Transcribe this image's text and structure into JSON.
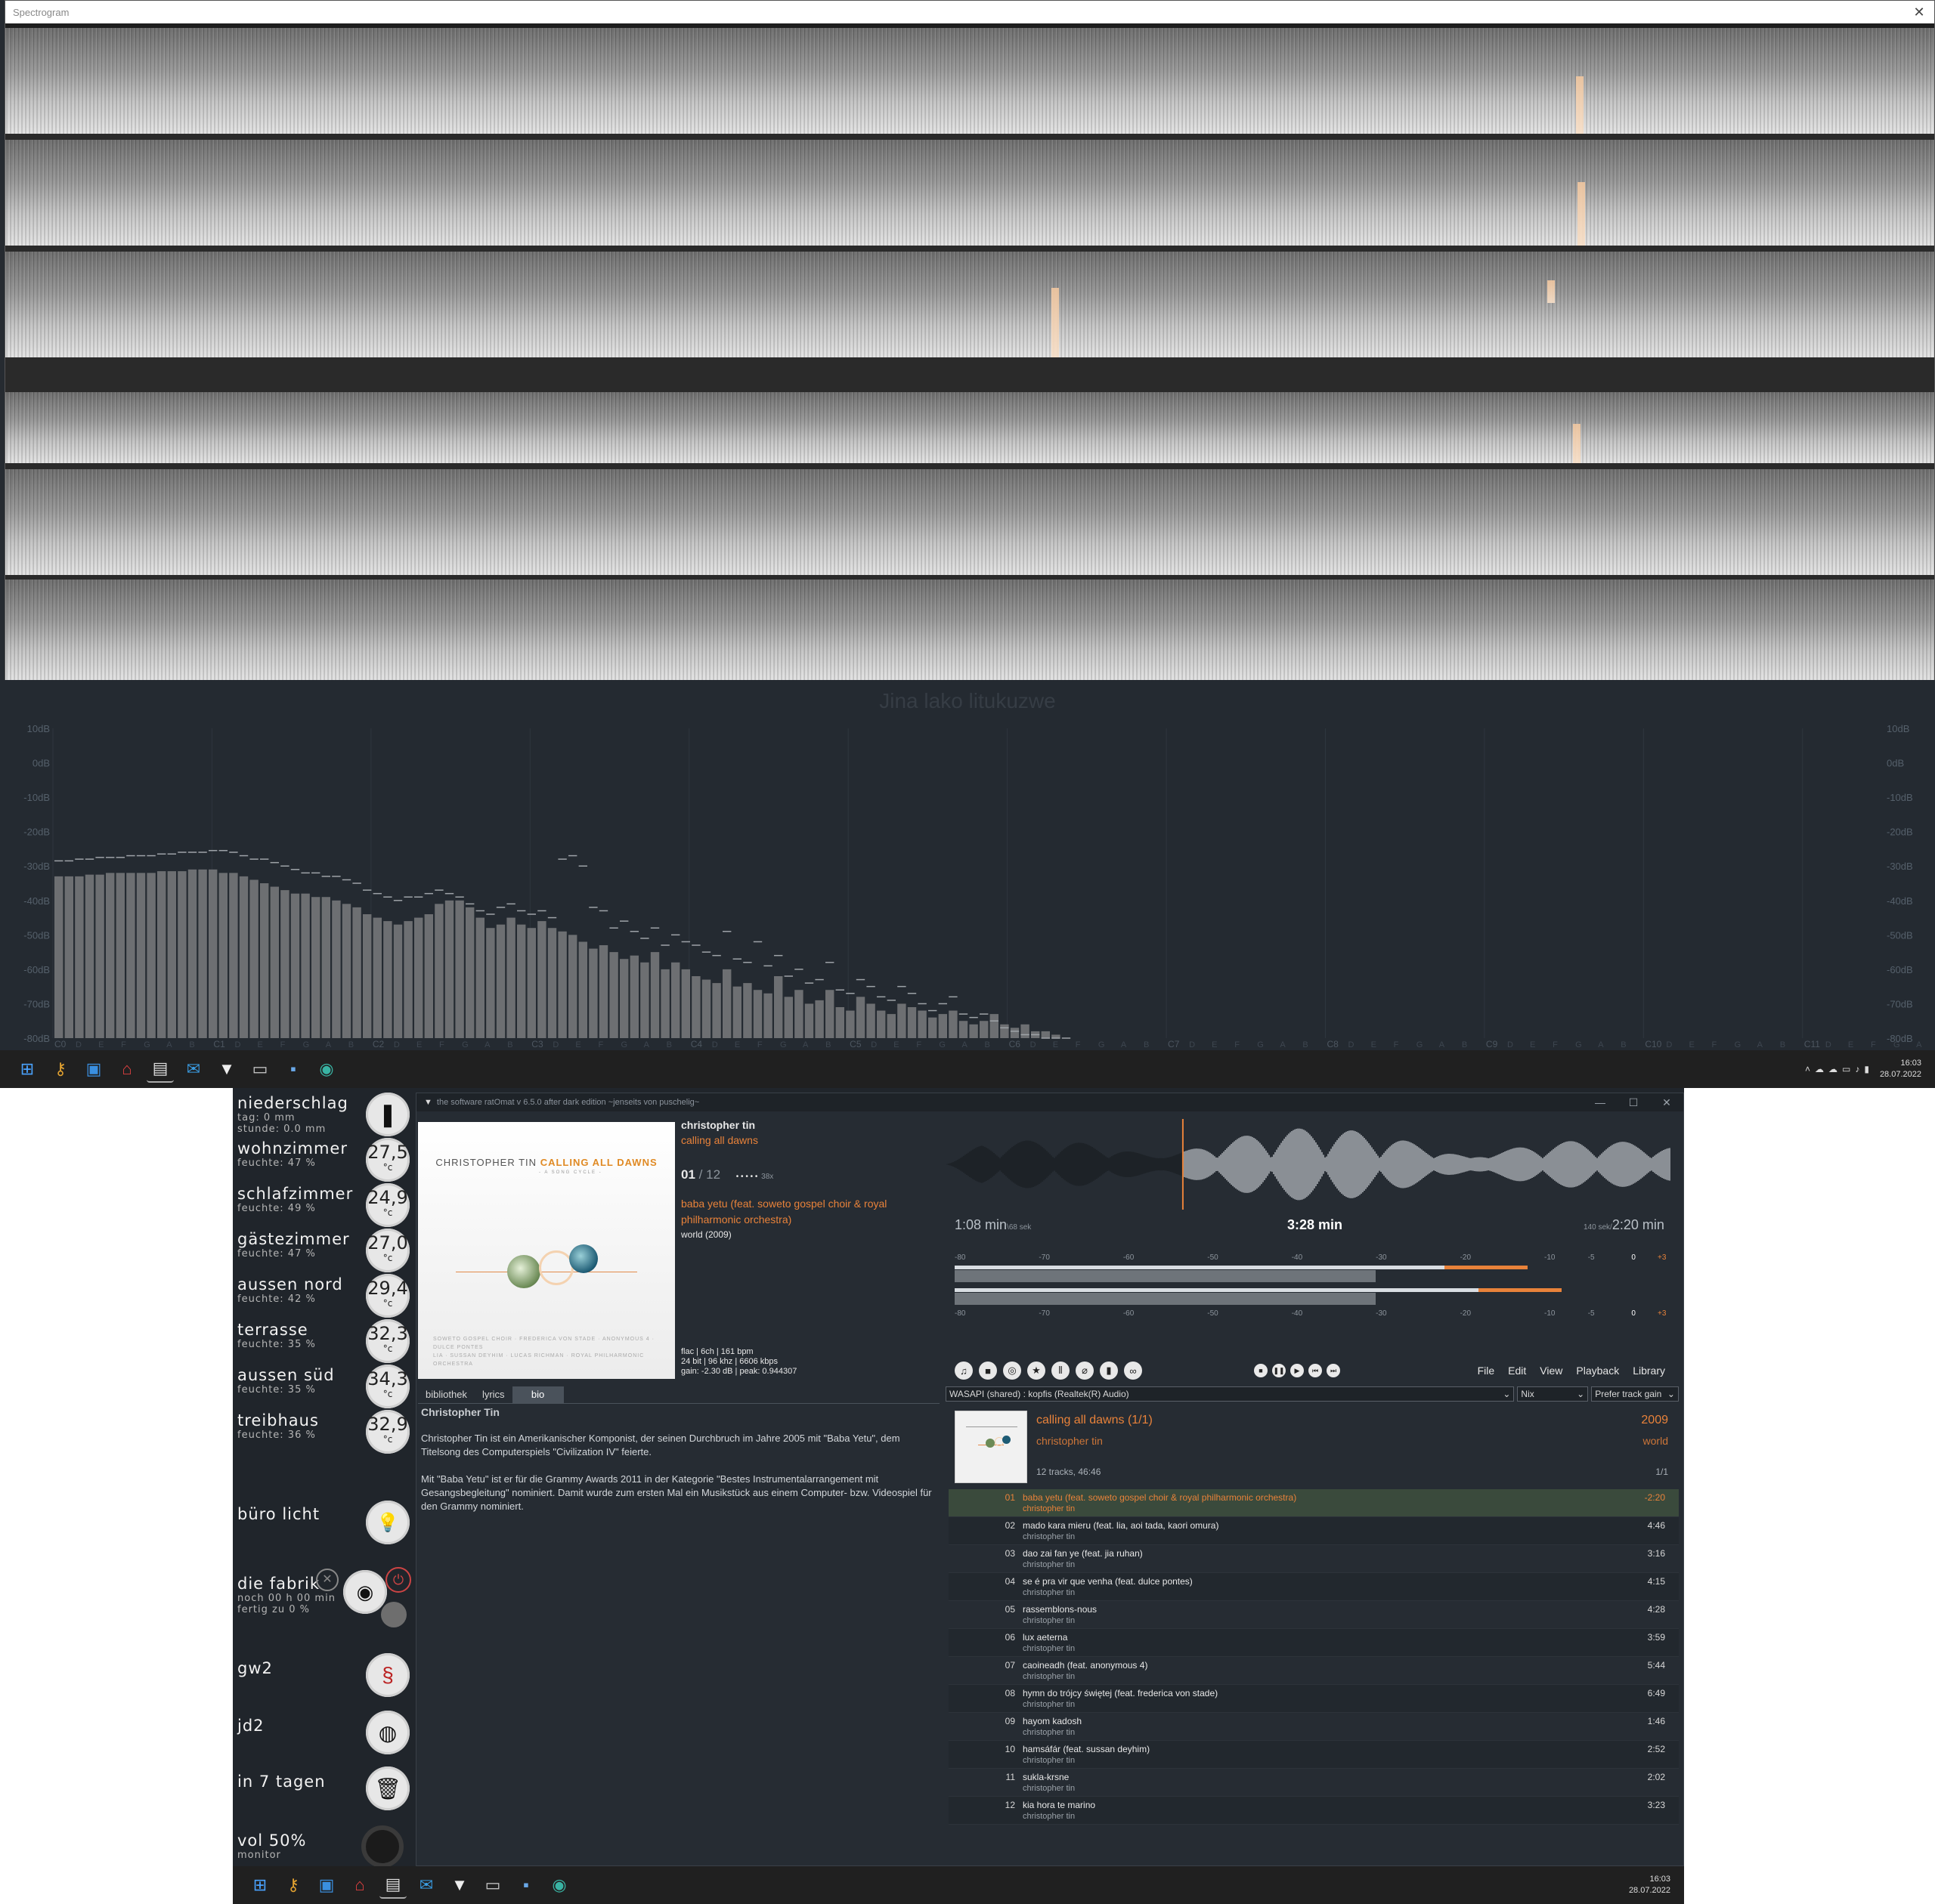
{
  "spectrogram": {
    "title": "Spectrogram",
    "close_glyph": "✕"
  },
  "spectrum": {
    "title": "Jina lako litukuzwe",
    "db_labels": [
      "10dB",
      "0dB",
      "-10dB",
      "-20dB",
      "-30dB",
      "-40dB",
      "-50dB",
      "-60dB",
      "-70dB",
      "-80dB"
    ],
    "octave_labels": [
      "C0",
      "C1",
      "C2",
      "C3",
      "C4",
      "C5",
      "C6",
      "C7",
      "C8",
      "C9",
      "C10",
      "C11"
    ],
    "bar_levels_db": [
      -33,
      -33,
      -33,
      -32.5,
      -32.5,
      -32,
      -32,
      -32,
      -32,
      -32,
      -31.5,
      -31.5,
      -31.5,
      -31,
      -31,
      -31,
      -32,
      -32,
      -33,
      -34,
      -35,
      -36,
      -37,
      -38,
      -38,
      -39,
      -39,
      -40,
      -41,
      -42,
      -44,
      -45,
      -46,
      -47,
      -46,
      -45,
      -44,
      -41,
      -40,
      -40,
      -42,
      -45,
      -48,
      -47,
      -45,
      -47,
      -48,
      -46,
      -48,
      -49,
      -50,
      -52,
      -54,
      -53,
      -55,
      -57,
      -56,
      -58,
      -55,
      -60,
      -58,
      -60,
      -62,
      -63,
      -64,
      -60,
      -65,
      -64,
      -66,
      -67,
      -62,
      -68,
      -66,
      -70,
      -69,
      -66,
      -71,
      -72,
      -68,
      -70,
      -72,
      -73,
      -70,
      -71,
      -72,
      -74,
      -73,
      -72,
      -75,
      -76,
      -75,
      -73,
      -76,
      -77,
      -76,
      -78,
      -78,
      -79,
      -80
    ],
    "peak_levels_db": [
      -28.5,
      -28.5,
      -28,
      -28,
      -27.5,
      -27.5,
      -27.5,
      -27,
      -27,
      -27,
      -26.5,
      -26.5,
      -26,
      -26,
      -26,
      -25.5,
      -25.5,
      -26,
      -27,
      -28,
      -28,
      -29,
      -30,
      -31,
      -32,
      -32,
      -33,
      -33,
      -34,
      -35,
      -37,
      -38,
      -39,
      -40,
      -39,
      -39,
      -38,
      -37,
      -38,
      -39,
      -41,
      -43,
      -44,
      -42,
      -41,
      -43,
      -44,
      -43,
      -45,
      -28,
      -27,
      -30,
      -42,
      -43,
      -48,
      -46,
      -49,
      -51,
      -48,
      -53,
      -50,
      -52,
      -53,
      -55,
      -56,
      -49,
      -57,
      -58,
      -52,
      -59,
      -56,
      -62,
      -60,
      -64,
      -63,
      -58,
      -66,
      -67,
      -63,
      -65,
      -68,
      -69,
      -65,
      -67,
      -70,
      -72,
      -70,
      -68,
      -73,
      -74,
      -73,
      -75,
      -77,
      -78,
      -79,
      -79,
      -80,
      -80,
      -80
    ],
    "tick_letters": [
      "D",
      "E",
      "F",
      "G",
      "A",
      "B"
    ]
  },
  "taskbar_top": {
    "icons": [
      "windows-start-icon",
      "key-icon",
      "window-icon",
      "home-icon",
      "player-icon",
      "mail-icon",
      "fox-icon",
      "terminal-icon",
      "save-icon",
      "edge-icon"
    ],
    "clock_time": "16:03",
    "clock_date": "28.07.2022"
  },
  "rainmeter": {
    "niederschlag": {
      "name": "niederschlag",
      "line1": "tag:      0 mm",
      "line2": "stunde: 0.0 mm"
    },
    "rooms": [
      {
        "name": "wohnzimmer",
        "sub": "feuchte: 47 %",
        "temp": "27,5"
      },
      {
        "name": "schlafzimmer",
        "sub": "feuchte: 49 %",
        "temp": "24,9"
      },
      {
        "name": "gästezimmer",
        "sub": "feuchte: 47 %",
        "temp": "27,0"
      },
      {
        "name": "aussen nord",
        "sub": "feuchte: 42 %",
        "temp": "29,4"
      },
      {
        "name": "terrasse",
        "sub": "feuchte: 35 %",
        "temp": "32,3"
      },
      {
        "name": "aussen süd",
        "sub": "feuchte: 35 %",
        "temp": "34,3"
      },
      {
        "name": "treibhaus",
        "sub": "feuchte: 36 %",
        "temp": "32,9"
      }
    ],
    "temp_unit": "°c",
    "buero": {
      "name": "büro licht"
    },
    "fabrik": {
      "name": "die fabrik",
      "line1": "noch 00 h 00 min",
      "line2": "fertig zu 0 %"
    },
    "gw2": {
      "name": "gw2"
    },
    "jd2": {
      "name": "jd2"
    },
    "muell": {
      "name": "in 7 tagen"
    },
    "vol": {
      "name": "vol 50%",
      "sub": "monitor"
    }
  },
  "player": {
    "window_title": "the software ratOmat v 6.5.0 after dark edition ~jenseits von puschelig~",
    "window_buttons": [
      "—",
      "☐",
      "✕"
    ],
    "cover": {
      "artist": "CHRISTOPHER TIN",
      "album": "CALLING ALL DAWNS",
      "subtitle": "- A SONG CYCLE -",
      "credits1": "SOWETO GOSPEL CHOIR · FREDERICA VON STADE · ANONYMOUS 4 · DULCE PONTES",
      "credits2": "LIA · SUSSAN DEYHIM · LUCAS RICHMAN · ROYAL PHILHARMONIC ORCHESTRA"
    },
    "artist": "christopher tin",
    "album": "calling all dawns",
    "track_no": "01",
    "track_sep": "/",
    "track_total": "12",
    "rating_dots": "• • • • •",
    "play_count": "38x",
    "title": "baba yetu (feat. soweto gospel choir & royal philharmonic orchestra)",
    "genre_year": "world (2009)",
    "tech1": "flac | 6ch | 161 bpm",
    "tech2": "24 bit | 96 khz | 6606 kbps",
    "tech3": "gain: -2.30 dB | peak: 0.944307",
    "tabs": [
      "bibliothek",
      "lyrics",
      "bio"
    ],
    "active_tab": "bio",
    "bio_name": "Christopher Tin",
    "bio_p1": "Christopher Tin ist ein Amerikanischer Komponist, der seinen Durchbruch im Jahre 2005 mit \"Baba Yetu\", dem Titelsong des Computerspiels \"Civilization IV\" feierte.",
    "bio_p2": "Mit \"Baba Yetu\" ist er für die Grammy Awards 2011 in der Kategorie \"Bestes Instrumentalarrangement mit Gesangsbegleitung\" nominiert. Damit wurde zum ersten Mal ein Musikstück aus einem Computer- bzw. Videospiel für den Grammy nominiert.",
    "time_elapsed": "1:08 min",
    "time_elapsed_sec": "\\68 sek",
    "time_total": "3:28 min",
    "time_remaining_sec": "140 sek/",
    "time_remaining": "2:20 min",
    "progress_fraction": 0.327,
    "meter_scale": [
      "-80",
      "-70",
      "-60",
      "-50",
      "-40",
      "-30",
      "-20",
      "-10",
      "-5",
      "0",
      "+3"
    ],
    "meter1": {
      "level_db": -30,
      "peak_db": -12
    },
    "meter2": {
      "level_db": -30,
      "peak_db": -8
    },
    "control_icons": [
      "music-note-icon",
      "stop-square-icon",
      "eye-icon",
      "star-icon",
      "equalizer-icon",
      "clip-icon",
      "chart-icon",
      "link-icon"
    ],
    "transport_icons": [
      "stop-icon",
      "pause-icon",
      "play-icon",
      "prev-icon",
      "next-icon"
    ],
    "menu": [
      "File",
      "Edit",
      "View",
      "Playback",
      "Library"
    ],
    "output_device": "WASAPI (shared) : kopfis (Realtek(R) Audio)",
    "dsp": "Nix",
    "replaygain": "Prefer track gain",
    "album_header": {
      "title": "calling all dawns (1/1)",
      "artist": "christopher tin",
      "year": "2009",
      "genre": "world",
      "summary": "12 tracks, 46:46",
      "disc": "1/1"
    },
    "tracks": [
      {
        "num": "01",
        "title": "baba yetu (feat. soweto gospel choir & royal philharmonic orchestra)",
        "artist": "christopher tin",
        "dur": "-2:20",
        "playing": true
      },
      {
        "num": "02",
        "title": "mado kara mieru (feat. lia, aoi tada, kaori omura)",
        "artist": "christopher tin",
        "dur": "4:46"
      },
      {
        "num": "03",
        "title": "dao zai fan ye (feat. jia ruhan)",
        "artist": "christopher tin",
        "dur": "3:16"
      },
      {
        "num": "04",
        "title": "se é pra vir que venha (feat. dulce pontes)",
        "artist": "christopher tin",
        "dur": "4:15"
      },
      {
        "num": "05",
        "title": "rassemblons-nous",
        "artist": "christopher tin",
        "dur": "4:28"
      },
      {
        "num": "06",
        "title": "lux aeterna",
        "artist": "christopher tin",
        "dur": "3:59"
      },
      {
        "num": "07",
        "title": "caoineadh (feat. anonymous 4)",
        "artist": "christopher tin",
        "dur": "5:44"
      },
      {
        "num": "08",
        "title": "hymn do trójcy świętej (feat. frederica von stade)",
        "artist": "christopher tin",
        "dur": "6:49"
      },
      {
        "num": "09",
        "title": "hayom kadosh",
        "artist": "christopher tin",
        "dur": "1:46"
      },
      {
        "num": "10",
        "title": "hamsáfár (feat. sussan deyhim)",
        "artist": "christopher tin",
        "dur": "2:52"
      },
      {
        "num": "11",
        "title": "sukla-krsne",
        "artist": "christopher tin",
        "dur": "2:02"
      },
      {
        "num": "12",
        "title": "kia hora te marino",
        "artist": "christopher tin",
        "dur": "3:23"
      }
    ]
  },
  "taskbar_bottom": {
    "clock_time": "16:03",
    "clock_date": "28.07.2022"
  },
  "colors": {
    "accent": "#e8823a",
    "background": "#20252b"
  }
}
